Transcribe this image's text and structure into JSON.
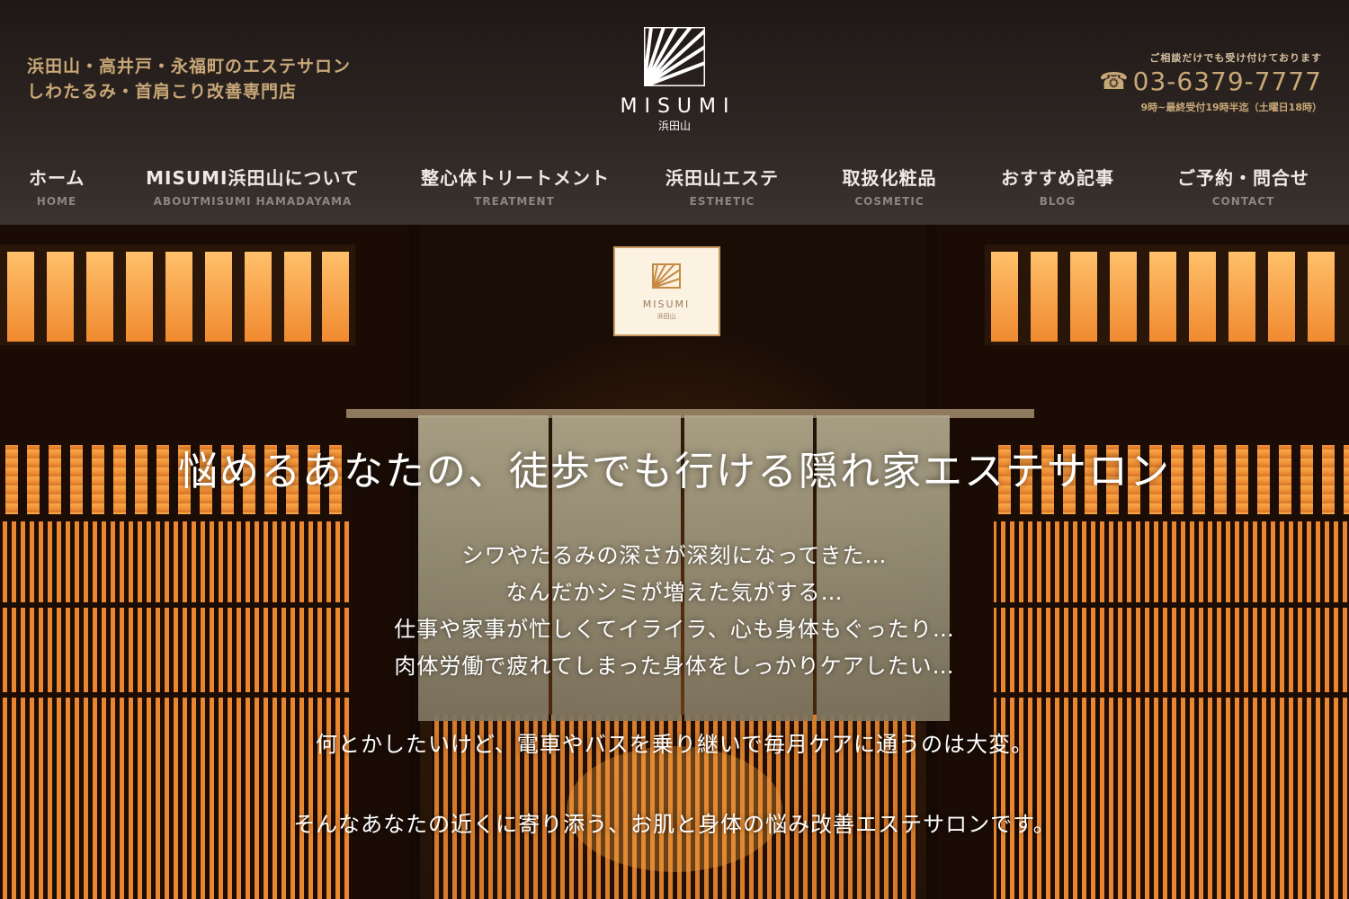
{
  "header": {
    "tagline": [
      "浜田山・高井戸・永福町のエステサロン",
      "しわたるみ・首肩こり改善専門店"
    ],
    "logo": {
      "name": "MISUMI",
      "sub": "浜田山"
    },
    "contact": {
      "note": "ご相談だけでも受け付けております",
      "phone_icon": "☎",
      "phone": "03-6379-7777",
      "hours": "9時~最終受付19時半迄（土曜日18時）"
    }
  },
  "nav": {
    "items": [
      {
        "label": "ホーム",
        "en": "HOME"
      },
      {
        "label": "MISUMI浜田山について",
        "en": "ABOUTMISUMI HAMADAYAMA"
      },
      {
        "label": "整心体トリートメント",
        "en": "TREATMENT"
      },
      {
        "label": "浜田山エステ",
        "en": "ESTHETIC"
      },
      {
        "label": "取扱化粧品",
        "en": "COSMETIC"
      },
      {
        "label": "おすすめ記事",
        "en": "BLOG"
      },
      {
        "label": "ご予約・問合せ",
        "en": "CONTACT"
      }
    ]
  },
  "hero": {
    "sign": {
      "name": "MISUMI",
      "sub": "浜田山"
    },
    "headline": "悩めるあなたの、徒歩でも行ける隠れ家エステサロン",
    "body": [
      "シワやたるみの深さが深刻になってきた…",
      "なんだかシミが増えた気がする…",
      "仕事や家事が忙しくてイライラ、心も身体もぐったり…",
      "肉体労働で疲れてしまった身体をしっかりケアしたい…"
    ],
    "line1": "何とかしたいけど、電車やバスを乗り継いで毎月ケアに通うのは大変。",
    "line2": "そんなあなたの近くに寄り添う、お肌と身体の悩み改善エステサロンです。"
  },
  "colors": {
    "header_bg": "#2c2522",
    "gold": "#c9a878",
    "nav_text": "#efe9e4",
    "nav_sub": "#8c8580",
    "lattice_glow": "#f09a3c"
  }
}
